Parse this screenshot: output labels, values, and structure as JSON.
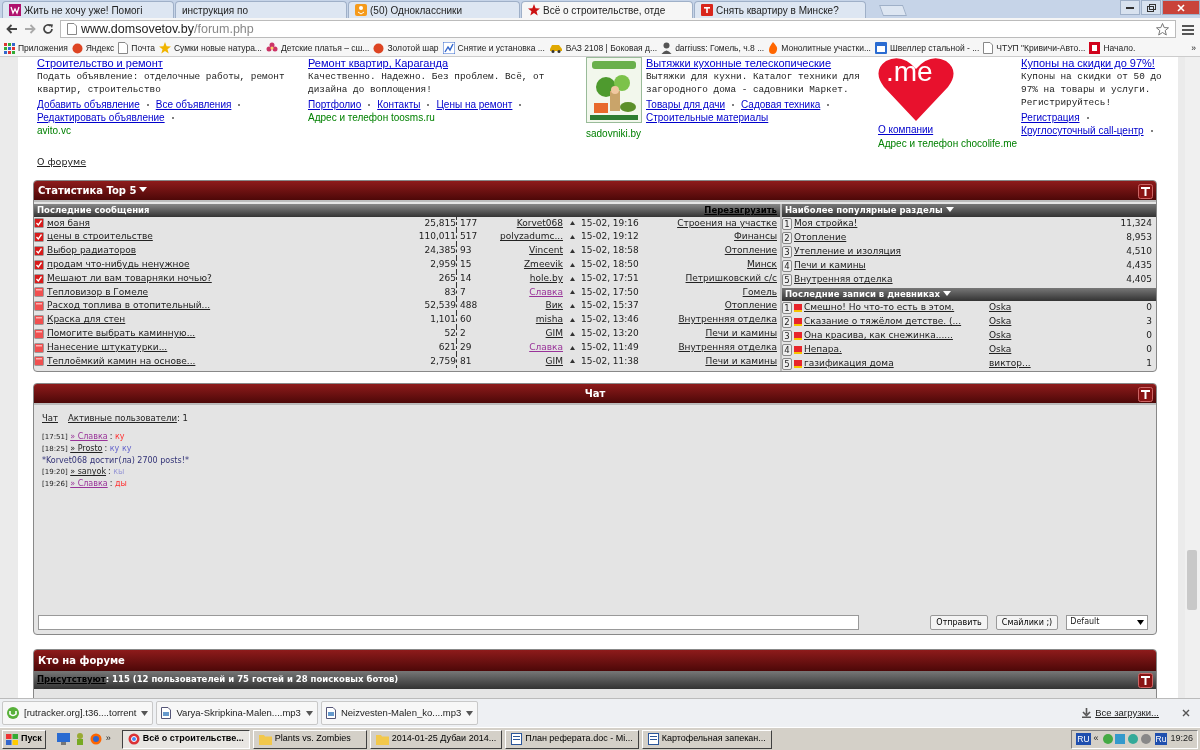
{
  "browser": {
    "tabs": [
      {
        "title": "Жить не хочу уже! Помогі",
        "kind": "magenta",
        "selected": false
      },
      {
        "title": "инструкция по",
        "kind": "none",
        "selected": false
      },
      {
        "title": "(50) Одноклассники",
        "kind": "orange",
        "selected": false
      },
      {
        "title": "Всё о строительстве, отде",
        "kind": "star",
        "selected": true
      },
      {
        "title": "Снять квартиру в Минске?",
        "kind": "red",
        "selected": false
      }
    ],
    "url_host": "www.domsovetov.by",
    "url_path": "/forum.php",
    "bookmarks": [
      {
        "label": "Приложения",
        "kind": "grid"
      },
      {
        "label": "Яндекс",
        "kind": "redcircle"
      },
      {
        "label": "Почта",
        "kind": "page"
      },
      {
        "label": "Сумки новые натура...",
        "kind": "star"
      },
      {
        "label": "Детские платья – сш...",
        "kind": "flower"
      },
      {
        "label": "Золотой шар",
        "kind": "redcircle"
      },
      {
        "label": "Снятие и установка ...",
        "kind": "chart"
      },
      {
        "label": "ВАЗ 2108 | Боковая д...",
        "kind": "car"
      },
      {
        "label": "darriuss: Гомель, ч.8 ...",
        "kind": "person"
      },
      {
        "label": "Монолитные участки...",
        "kind": "fire"
      },
      {
        "label": "Швеллер стальной - ...",
        "kind": "calendar"
      },
      {
        "label": "ЧТУП \"Кривичи-Авто...",
        "kind": "page"
      },
      {
        "label": "Начало.",
        "kind": "redsquare"
      }
    ],
    "more": "»"
  },
  "ads": [
    {
      "kind": "text",
      "title": "Строительство и ремонт",
      "description": "Подать объявление: отделочные работы, ремонт квартир, строительство",
      "links": [
        "Добавить объявление",
        "Все объявления",
        "Редактировать объявление"
      ],
      "footer": "avito.vc"
    },
    {
      "kind": "text",
      "title": "Ремонт квартир, Караганда",
      "description": "Качественно. Надежно. Без проблем. Всё, от дизайна до воплощения!",
      "links": [
        "Портфолио",
        "Контакты",
        "Цены на ремонт"
      ],
      "footer": "Адрес и телефон  toosms.ru"
    },
    {
      "title": "Вытяжки кухонные телескопические",
      "description": "Вытяжки для кухни. Каталог техники для загородного дома - садовники Маркет.",
      "links": [
        "Товары для дачи",
        "Садовая техника",
        "Строительные материалы"
      ],
      "footer": "sadovniki.by"
    },
    {
      "kind": "logo",
      "title": "Купоны на скидки до 97%!",
      "description": "Купоны на скидки от 50 до 97% на товары и услуги. Регистрируйтесь!",
      "links": [
        "Регистрация",
        "Круглосуточный call-центр"
      ],
      "logo_text": ".me",
      "extra_link": "О компании",
      "footer": "Адрес и телефон  chocolife.me"
    }
  ],
  "about_link": "О форуме",
  "stats": {
    "title": "Статистика Top 5",
    "latest": {
      "title": "Последние сообщения",
      "reload": "Перезагрузить",
      "rows": [
        {
          "title": "моя баня",
          "views": "25,815",
          "replies": "177",
          "author": "Korvet068",
          "highlighted": false,
          "date": "15-02, 19:16",
          "forum": "Строения на участке",
          "unread": true
        },
        {
          "title": "цены в строительстве",
          "views": "110,011",
          "replies": "517",
          "author": "polyzadumc...",
          "highlighted": false,
          "date": "15-02, 19:12",
          "forum": "Финансы",
          "unread": true
        },
        {
          "title": "Выбор радиаторов",
          "views": "24,385",
          "replies": "93",
          "author": "Vincent",
          "highlighted": false,
          "date": "15-02, 18:58",
          "forum": "Отопление",
          "unread": true
        },
        {
          "title": "продам что-нибудь ненужное",
          "views": "2,959",
          "replies": "15",
          "author": "Zmeevik",
          "highlighted": false,
          "date": "15-02, 18:50",
          "forum": "Минск",
          "unread": true
        },
        {
          "title": "Мешают ли вам товарняки ночью?",
          "views": "265",
          "replies": "14",
          "author": "hole.by",
          "highlighted": false,
          "date": "15-02, 17:51",
          "forum": "Петришковский с/с",
          "unread": true
        },
        {
          "title": "Тепловизор в Гомеле",
          "views": "83",
          "replies": "7",
          "author": "Славка",
          "highlighted": true,
          "date": "15-02, 17:50",
          "forum": "Гомель",
          "unread": false
        },
        {
          "title": "Расход топлива в отопительный...",
          "views": "52,539",
          "replies": "488",
          "author": "Вик",
          "highlighted": false,
          "date": "15-02, 15:37",
          "forum": "Отопление",
          "unread": false
        },
        {
          "title": "Краска для стен",
          "views": "1,101",
          "replies": "60",
          "author": "misha",
          "highlighted": false,
          "date": "15-02, 13:46",
          "forum": "Внутренняя отделка",
          "unread": false
        },
        {
          "title": "Помогите выбрать каминную...",
          "views": "52",
          "replies": "2",
          "author": "GIM",
          "highlighted": false,
          "date": "15-02, 13:20",
          "forum": "Печи и камины",
          "unread": false
        },
        {
          "title": "Нанесение штукатурки...",
          "views": "621",
          "replies": "29",
          "author": "Славка",
          "highlighted": true,
          "date": "15-02, 11:49",
          "forum": "Внутренняя отделка",
          "unread": false
        },
        {
          "title": "Теплоёмкий камин на основе...",
          "views": "2,759",
          "replies": "81",
          "author": "GIM",
          "highlighted": false,
          "date": "15-02, 11:38",
          "forum": "Печи и камины",
          "unread": false
        }
      ]
    },
    "popular": {
      "title": "Наиболее популярные разделы",
      "rows": [
        {
          "rank": "1",
          "title": "Моя стройка!",
          "count": "11,324"
        },
        {
          "rank": "2",
          "title": "Отопление",
          "count": "8,953"
        },
        {
          "rank": "3",
          "title": "Утепление и изоляция",
          "count": "4,510"
        },
        {
          "rank": "4",
          "title": "Печи и камины",
          "count": "4,435"
        },
        {
          "rank": "5",
          "title": "Внутренняя отделка",
          "count": "4,405"
        }
      ]
    },
    "diaries": {
      "title": "Последние записи в дневниках",
      "rows": [
        {
          "rank": "1",
          "title": "Смешно! Но что-то есть в этом.",
          "author": "Oska",
          "count": "0"
        },
        {
          "rank": "2",
          "title": "Сказание о тяжёлом детстве. (...",
          "author": "Oska",
          "count": "3"
        },
        {
          "rank": "3",
          "title": "Она красива, как снежинка......",
          "author": "Oska",
          "count": "0"
        },
        {
          "rank": "4",
          "title": "Непара.",
          "author": "Oska",
          "count": "0"
        },
        {
          "rank": "5",
          "title": "газификация дома",
          "author": "виктор...",
          "count": "1"
        }
      ]
    }
  },
  "chat": {
    "title": "Чат",
    "tabs": [
      {
        "label": "Чат"
      },
      {
        "label": "Активные пользователи",
        "count_text": ": 1"
      }
    ],
    "messages": [
      {
        "kind": "user",
        "time": "[17:51]",
        "arrow": "»",
        "user": "Славка",
        "highlighted": true,
        "colon": ":",
        "text": "ку",
        "emphasized": true,
        "faded": false
      },
      {
        "kind": "user",
        "time": "[18:25]",
        "arrow": "»",
        "user": "Prosto",
        "highlighted": false,
        "colon": ":",
        "text": "ку ку",
        "emphasized": false,
        "faded": false
      },
      {
        "kind": "system",
        "text": "*Korvet068 достиг(ла) 2700 posts!*"
      },
      {
        "kind": "user",
        "time": "[19:20]",
        "arrow": "»",
        "user": "sanyok",
        "highlighted": false,
        "colon": ":",
        "text": "кы",
        "emphasized": false,
        "faded": true
      },
      {
        "kind": "user",
        "time": "[19:26]",
        "arrow": "»",
        "user": "Славка",
        "highlighted": true,
        "colon": ":",
        "text": "ды",
        "emphasized": true,
        "faded": false
      }
    ],
    "send": "Отправить",
    "smileys": "Смайлики ;)",
    "style": "Default"
  },
  "online": {
    "title": "Кто на форуме",
    "present_label": "Присутствуют",
    "present_text": ": 115 (12 пользователей и 75 гостей и 28 поисковых ботов)"
  },
  "downloads": {
    "items": [
      {
        "name": "[rutracker.org].t36....torrent",
        "kind": "torrent"
      },
      {
        "name": "Varya-Skripkina-Malen....mp3",
        "kind": "file"
      },
      {
        "name": "Neizvesten-Malen_ko....mp3",
        "kind": "file"
      }
    ],
    "all": "Все загрузки..."
  },
  "taskbar": {
    "start": "Пуск",
    "more": "»",
    "tasks": [
      {
        "label": "Всё о строительстве...",
        "kind": "browser",
        "selected": true
      },
      {
        "label": "Plants vs. Zombies",
        "kind": "folder",
        "selected": false
      },
      {
        "label": "2014-01-25 Дубаи 2014...",
        "kind": "folder",
        "selected": false
      },
      {
        "label": "План реферата.doc - Mi...",
        "kind": "doc",
        "selected": false
      },
      {
        "label": "Картофельная запекан...",
        "kind": "doc",
        "selected": false
      }
    ],
    "lang": "RU",
    "tray_more": "«",
    "tray_lang": "Ru",
    "clock": "19:26"
  }
}
